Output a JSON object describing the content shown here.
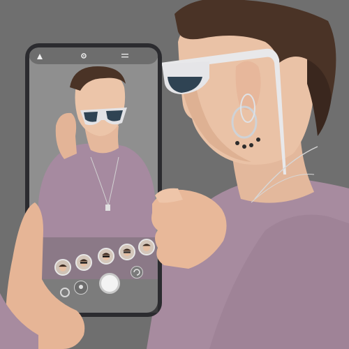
{
  "scene": {
    "description_colors": {
      "background": "#6f6f6f",
      "sweater": "#a88aa0",
      "skin": "#e9c0a6",
      "hair": "#4a3428",
      "phone_frame": "#2b2b2f",
      "phone_screen_bg": "#9c9c9c",
      "sunglasses_frame": "#e8e8ea",
      "lens": "#2f4353"
    }
  },
  "phone": {
    "status_icons": [
      "app-logo-icon",
      "gear-icon",
      "menu-icon"
    ],
    "filter_thumbnails": [
      "face-filter-1",
      "face-filter-2",
      "face-filter-3",
      "face-filter-4",
      "face-filter-5"
    ],
    "controls": [
      "record-icon",
      "gallery-icon",
      "shutter-button",
      "flip-camera-icon"
    ]
  }
}
